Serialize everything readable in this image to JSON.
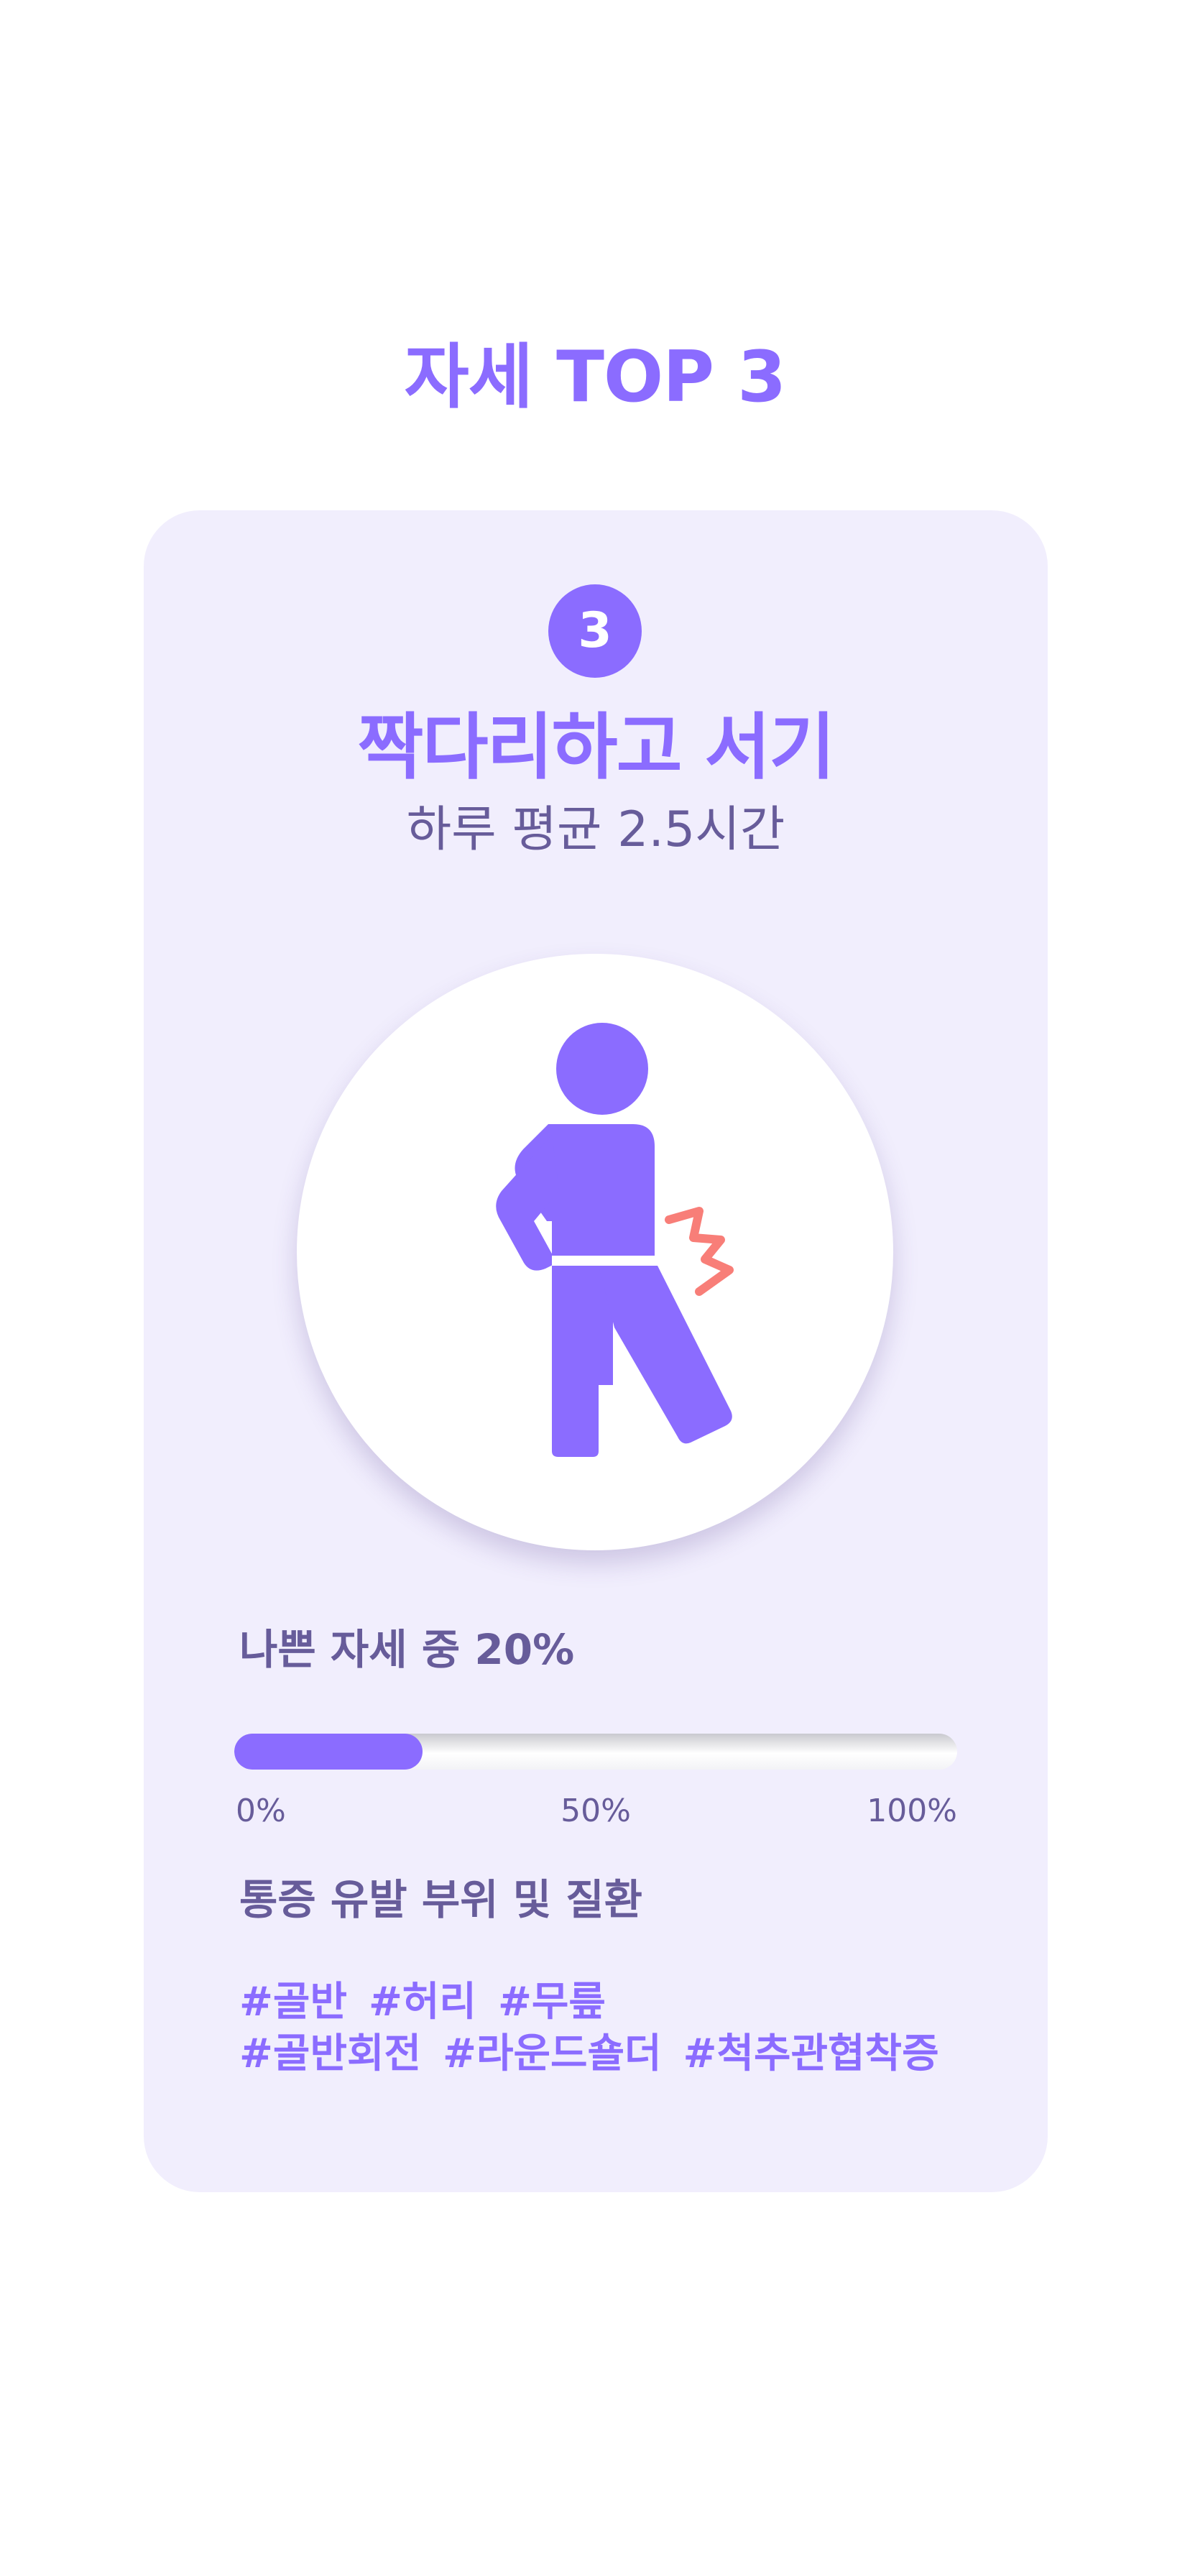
{
  "header": {
    "title": "자세 TOP 3"
  },
  "card": {
    "rank": "3",
    "posture_name": "짝다리하고 서기",
    "daily_average": "하루 평균 2.5시간",
    "illustration_icon": "person-leg-cross-back-pain-icon",
    "ratio_label": "나쁜 자세 중 20%",
    "progress": {
      "value_percent": 26,
      "ticks": [
        "0%",
        "50%",
        "100%"
      ]
    },
    "related_title": "통증 유발 부위 및 질환",
    "tags": [
      [
        "#골반",
        "#허리",
        "#무릎"
      ],
      [
        "#골반회전",
        "#라운드숄더",
        "#척추관협착증"
      ]
    ]
  },
  "colors": {
    "accent": "#8b6cff",
    "card_bg": "#f1eefd",
    "text_muted": "#675c9a",
    "pain_mark": "#f87e78"
  }
}
